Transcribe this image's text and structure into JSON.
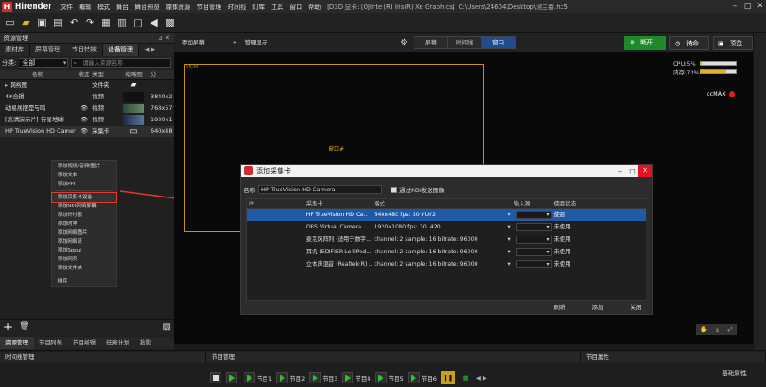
{
  "app": {
    "name": "Hirender",
    "menu": [
      "文件",
      "编辑",
      "模式",
      "舞台",
      "舞台预览",
      "媒体资源",
      "节目管理",
      "时间线",
      "灯库",
      "工具",
      "窗口",
      "帮助"
    ],
    "d3d_info": "[D3D 显卡: [0]Intel(R) Iris(R) Xe Graphics]",
    "file_path": "C:\\Users\\24604\\Desktop\\测主春.hc5"
  },
  "resource_panel": {
    "title": "资源管理",
    "tabs": [
      "素材库",
      "屏幕管理",
      "节目特效",
      "设备管理"
    ],
    "filter_label": "分类:",
    "filter_value": "全部",
    "search_placeholder": "请输入资源名称",
    "columns": [
      "名称",
      "状态",
      "类型",
      "缩略图",
      "分"
    ],
    "rows": [
      {
        "name": "网络图",
        "status": "",
        "type": "文件夹",
        "res": "",
        "thumb": "folder"
      },
      {
        "name": "4K合辑",
        "status": "",
        "type": "视频",
        "res": "3840x2",
        "thumb": "dark"
      },
      {
        "name": "动易展摆是与鸣",
        "status": "👁",
        "type": "视频",
        "res": "768x57",
        "thumb": "forest"
      },
      {
        "name": "[高清演示片]-行星地球",
        "status": "👁",
        "type": "视频",
        "res": "1920x1",
        "thumb": "earth"
      },
      {
        "name": "HP TrueVision HD Camera",
        "status": "👁",
        "type": "采集卡",
        "res": "640x48",
        "thumb": "camera"
      }
    ],
    "context_menu": [
      "添加视频/音频/图片",
      "添加文本",
      "添加PPT",
      "添加采集卡设备",
      "添加NDI网络屏幕",
      "添加计时器",
      "添加时钟",
      "添加网络图片",
      "添加网络流",
      "添加Spout",
      "添加网页",
      "添加文件夹",
      "排序"
    ],
    "context_highlight_index": 3,
    "bottom_tabs": [
      "资源管理",
      "节目列表",
      "节目编辑",
      "任务计划",
      "投影"
    ]
  },
  "center": {
    "add_screen": "添加屏幕",
    "manage_display": "管理显示",
    "view_tabs": [
      "屏幕",
      "时间线",
      "窗口"
    ],
    "active_view": 2,
    "stage_screen_label": "(0,0)",
    "stage_window_label": "窗口#",
    "cpu_label": "CPU:5%",
    "cpu_pct": 5,
    "mem_label": "内存:73%",
    "mem_pct": 73,
    "ccmax_label": "ccMAX"
  },
  "top_buttons": {
    "open": "断开",
    "standby": "待命",
    "preview": "预览"
  },
  "dialog": {
    "title": "添加采集卡",
    "name_label": "名称",
    "name_value": "HP TrueVision HD Camera",
    "ndi_checkbox_label": "通过NDI发送图像",
    "columns": [
      "IP",
      "采集卡",
      "格式",
      "输入源",
      "使用状态"
    ],
    "rows": [
      {
        "ip": "",
        "card": "HP TrueVision HD Ca...",
        "format": "640x480  fps: 30  YUY2",
        "input": "",
        "status": "使用"
      },
      {
        "ip": "",
        "card": "OBS Virtual Camera",
        "format": "1920x1080  fps: 30  I420",
        "input": "",
        "status": "未使用"
      },
      {
        "ip": "",
        "card": "麦克风阵列 (适用于数字...",
        "format": "channel: 2 sample: 16 bitrate: 96000",
        "input": "",
        "status": "未使用"
      },
      {
        "ip": "",
        "card": "耳机 (EDIFIER LolliPod...",
        "format": "channel: 2 sample: 16 bitrate: 96000",
        "input": "",
        "status": "未使用"
      },
      {
        "ip": "",
        "card": "立体声混音 (Realtek(R)...",
        "format": "channel: 2 sample: 16 bitrate: 96000",
        "input": "",
        "status": "未使用"
      }
    ],
    "selected_row": 0,
    "buttons": [
      "刷新",
      "添加",
      "关闭"
    ]
  },
  "bottom": {
    "timeline_title": "时间线管理",
    "program_title": "节目管理",
    "program_props": "节目属性",
    "basic_props": "基础属性",
    "programs": [
      "节目1",
      "节目2",
      "节目3",
      "节目4",
      "节目5",
      "节目6"
    ]
  },
  "colors": {
    "accent_blue": "#1e5aa8",
    "highlight_red": "#e03a2a",
    "stage_border": "#c89018",
    "open_green": "#1f8a2a"
  }
}
